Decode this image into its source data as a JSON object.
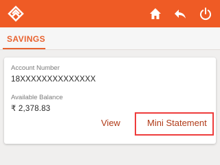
{
  "app": {
    "icons": {
      "logo": "bank-logo-icon",
      "home": "home-icon",
      "back": "back-arrow-icon",
      "power": "power-icon"
    },
    "colors": {
      "appbar": "#ef5b25",
      "accent": "#e8612e",
      "action_text": "#b03a17",
      "highlight": "#ee3b3b"
    }
  },
  "tabs": [
    {
      "label": "SAVINGS",
      "active": true
    }
  ],
  "account": {
    "number_label": "Account Number",
    "number_value": "18XXXXXXXXXXXXXX",
    "balance_label": "Available Balance",
    "balance_value": "₹ 2,378.83",
    "view_label": "View",
    "mini_statement_label": "Mini Statement"
  }
}
